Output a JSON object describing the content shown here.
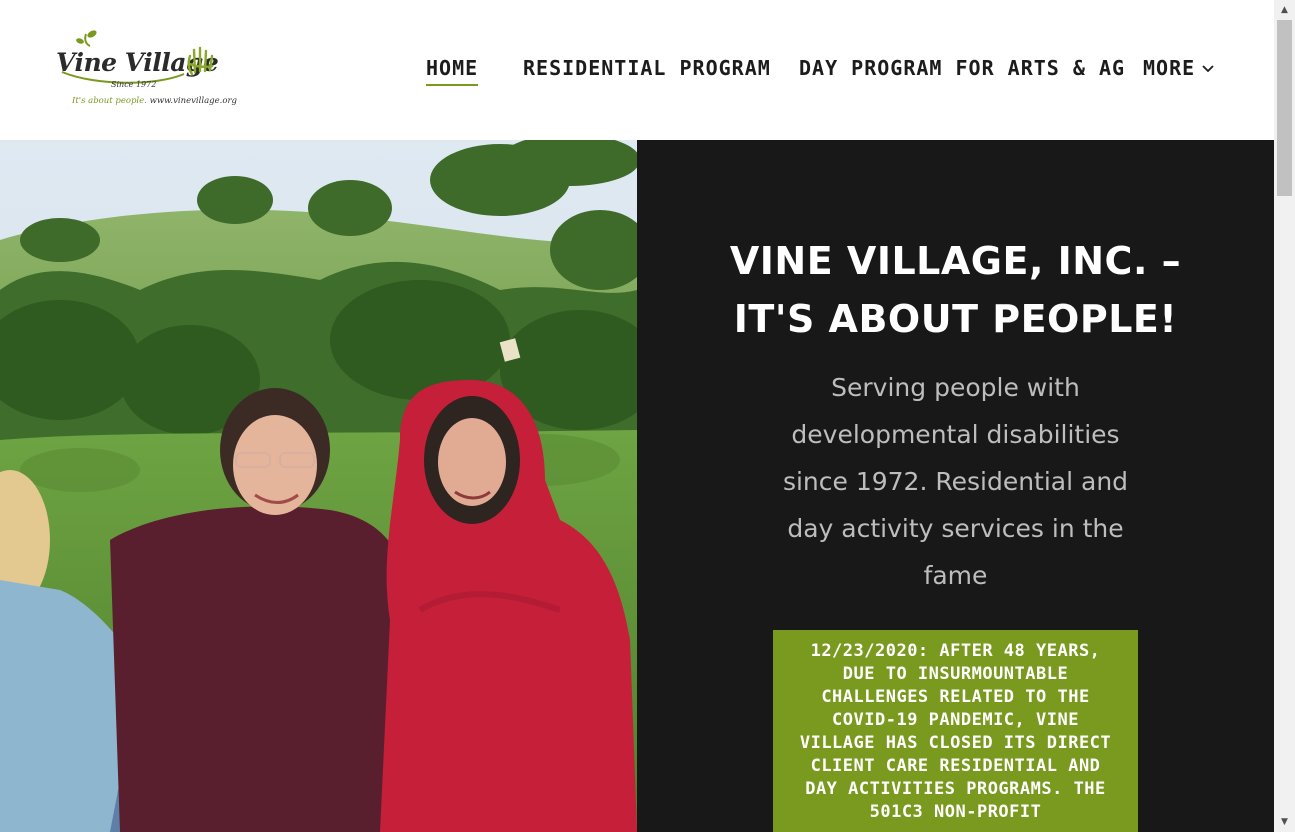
{
  "logo": {
    "title": "Vine Village",
    "since": "Since 1972",
    "tagline_green": "It's about people.",
    "tagline_url": "www.vinevillage.org"
  },
  "nav": {
    "home": "HOME",
    "residential": "RESIDENTIAL PROGRAM",
    "day_program": "DAY PROGRAM FOR ARTS & AG",
    "more": "MORE"
  },
  "hero": {
    "title_line1": "VINE VILLAGE, INC. –",
    "title_line2": "IT'S ABOUT PEOPLE!",
    "subtitle": "Serving people with developmental disabilities since 1972. Residential and day activity services in the fame",
    "notice": "12/23/2020: AFTER 48 YEARS, DUE TO INSURMOUNTABLE CHALLENGES RELATED TO THE COVID-19 PANDEMIC, VINE VILLAGE HAS CLOSED ITS DIRECT CLIENT CARE RESIDENTIAL AND DAY ACTIVITIES PROGRAMS. THE 501C3 NON-PROFIT"
  },
  "colors": {
    "accent_green": "#7a9a1f",
    "panel_dark": "#181818",
    "subtitle_gray": "#bdbdbd"
  },
  "icons": {
    "more_chevron": "chevron-down-icon",
    "logo_hand": "hand-icon",
    "scroll_up": "scroll-up-arrow-icon",
    "scroll_down": "scroll-down-arrow-icon"
  }
}
